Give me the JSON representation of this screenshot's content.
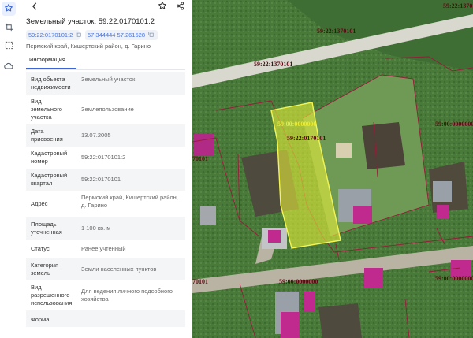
{
  "rail": {
    "items": [
      {
        "name": "star-icon",
        "active": true
      },
      {
        "name": "crop-icon",
        "active": false
      },
      {
        "name": "select-area-icon",
        "active": false
      },
      {
        "name": "cloud-icon",
        "active": false
      }
    ]
  },
  "panel": {
    "title": "Земельный участок: 59:22:0170101:2",
    "cad_chip": "59:22:0170101:2",
    "coord_chip": "57.344444 57.261528",
    "address_line": "Пермский край, Кишертский район, д. Гарино",
    "tab_label": "Информация",
    "rows": [
      {
        "key": "Вид объекта недвижимости",
        "value": "Земельный участок"
      },
      {
        "key": "Вид земельного участка",
        "value": "Землепользование"
      },
      {
        "key": "Дата присвоения",
        "value": "13.07.2005"
      },
      {
        "key": "Кадастровый номер",
        "value": "59:22:0170101:2"
      },
      {
        "key": "Кадастровый квартал",
        "value": "59:22:0170101"
      },
      {
        "key": "Адрес",
        "value": "Пермский край, Кишертский район, д. Гарино"
      },
      {
        "key": "Площадь уточненная",
        "value": "1 100 кв. м"
      },
      {
        "key": "Статус",
        "value": "Ранее учтенный"
      },
      {
        "key": "Категория земель",
        "value": "Земли населенных пунктов"
      },
      {
        "key": "Вид разрешенного использования",
        "value": "Для ведения личного подсобного хозяйства"
      },
      {
        "key": "Форма",
        "value": ""
      }
    ]
  },
  "map": {
    "labels": {
      "top_right": "59:22:1370",
      "road_upper": "59:22:1370101",
      "road_lower": "59:22:1370101",
      "parcel_code": "59:00:0000000",
      "parcel_cad": "59:22:0170101",
      "right_mid": "59:00:0000000",
      "left_mid": "70101",
      "bottom_left": "70101",
      "bottom_mid": "59:00:0000000",
      "bottom_right": "59:00:0000000"
    }
  }
}
